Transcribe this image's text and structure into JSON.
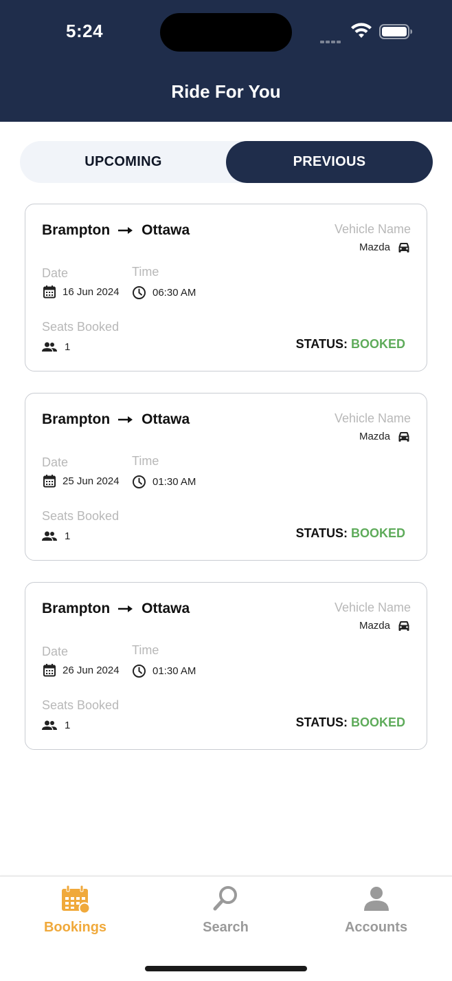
{
  "status_bar": {
    "time": "5:24"
  },
  "header": {
    "title": "Ride For You"
  },
  "segments": {
    "upcoming": "UPCOMING",
    "previous": "PREVIOUS",
    "active": "previous"
  },
  "bookings": [
    {
      "from": "Brampton",
      "to": "Ottawa",
      "vehicle_label": "Vehicle Name",
      "vehicle": "Mazda",
      "date_label": "Date",
      "date": "16 Jun 2024",
      "time_label": "Time",
      "time": "06:30 AM",
      "seats_label": "Seats Booked",
      "seats": "1",
      "status_label": "STATUS:",
      "status": "BOOKED"
    },
    {
      "from": "Brampton",
      "to": "Ottawa",
      "vehicle_label": "Vehicle Name",
      "vehicle": "Mazda",
      "date_label": "Date",
      "date": "25 Jun 2024",
      "time_label": "Time",
      "time": "01:30 AM",
      "seats_label": "Seats Booked",
      "seats": "1",
      "status_label": "STATUS:",
      "status": "BOOKED"
    },
    {
      "from": "Brampton",
      "to": "Ottawa",
      "vehicle_label": "Vehicle Name",
      "vehicle": "Mazda",
      "date_label": "Date",
      "date": "26 Jun 2024",
      "time_label": "Time",
      "time": "01:30 AM",
      "seats_label": "Seats Booked",
      "seats": "1",
      "status_label": "STATUS:",
      "status": "BOOKED"
    }
  ],
  "tabbar": {
    "items": [
      {
        "label": "Bookings",
        "icon": "calendar-icon",
        "active": true
      },
      {
        "label": "Search",
        "icon": "search-icon",
        "active": false
      },
      {
        "label": "Accounts",
        "icon": "person-icon",
        "active": false
      }
    ]
  },
  "colors": {
    "header_bg": "#1f2d4b",
    "status_booked": "#5eab5a",
    "tab_active": "#f0a93b",
    "tab_inactive": "#9a9a9a"
  }
}
